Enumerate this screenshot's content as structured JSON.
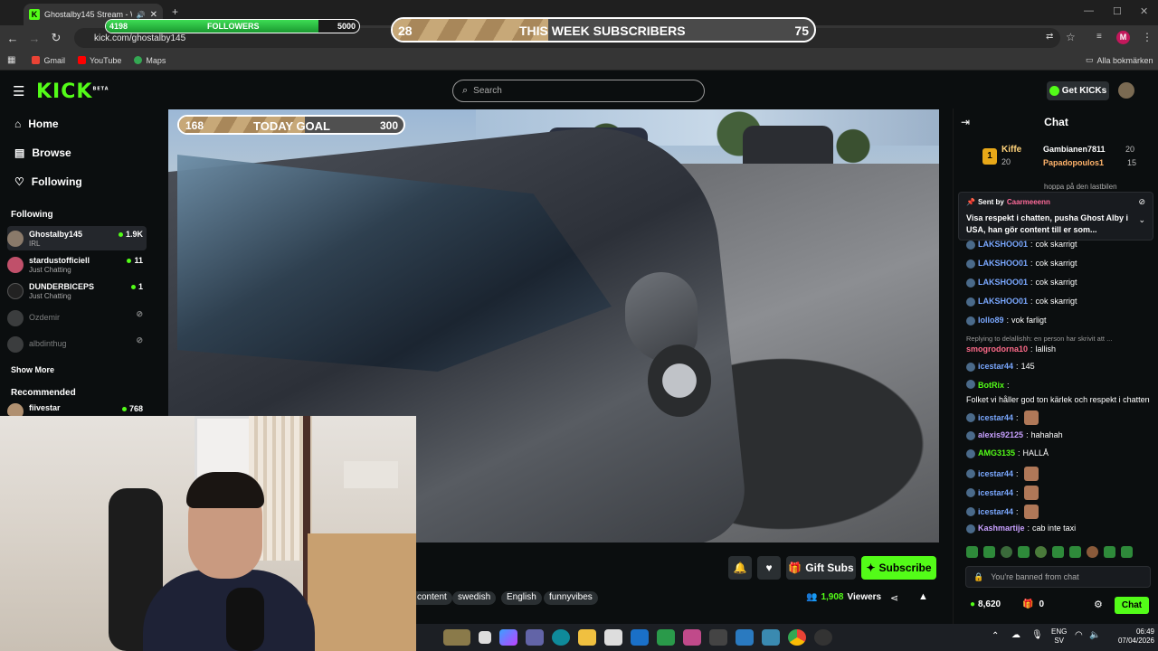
{
  "browser": {
    "tab_title": "Ghostalby145 Stream - Wa",
    "url": "kick.com/ghostalby145",
    "bookmarks": [
      "Gmail",
      "YouTube",
      "Maps"
    ],
    "all_bookmarks": "Alla bokmärken",
    "profile_initial": "M"
  },
  "overlay": {
    "followers_current": "4198",
    "followers_label": "FOLLOWERS",
    "followers_goal": "5000",
    "followers_progress": 0.84,
    "week_current": "28",
    "week_label": "THIS WEEK SUBSCRIBERS",
    "week_goal": "75",
    "week_progress": 0.37,
    "today_current": "168",
    "today_label": "TODAY GOAL",
    "today_goal": "300",
    "today_progress": 0.56
  },
  "header": {
    "logo": "KICK",
    "logo_badge": "BETA",
    "search_placeholder": "Search",
    "get_kicks": "Get KICKs"
  },
  "sidebar": {
    "nav": [
      {
        "label": "Home",
        "icon": "home-icon"
      },
      {
        "label": "Browse",
        "icon": "browse-icon"
      },
      {
        "label": "Following",
        "icon": "heart-icon"
      }
    ],
    "following_heading": "Following",
    "following": [
      {
        "name": "Ghostalby145",
        "sub": "IRL",
        "count": "1.9K",
        "live": true
      },
      {
        "name": "stardustofficiell",
        "sub": "Just Chatting",
        "count": "11",
        "live": true
      },
      {
        "name": "DUNDERBICEPS",
        "sub": "Just Chatting",
        "count": "1",
        "live": true
      },
      {
        "name": "Ozdemir",
        "sub": "",
        "count": "",
        "live": false
      },
      {
        "name": "albdinthug",
        "sub": "",
        "count": "",
        "live": false
      }
    ],
    "show_more": "Show More",
    "recommended_heading": "Recommended",
    "recommended": [
      {
        "name": "fiivestar",
        "count": "768"
      }
    ]
  },
  "stream": {
    "gift_subs": "Gift Subs",
    "subscribe": "Subscribe",
    "tags": [
      "content",
      "swedish",
      "English",
      "funnyvibes"
    ],
    "viewers": "1,908",
    "viewers_label": "Viewers"
  },
  "chat": {
    "title": "Chat",
    "leaders": [
      {
        "rank": "1",
        "name": "Kiffe",
        "count": "20"
      },
      {
        "name": "Gambianen7811",
        "count": "20"
      },
      {
        "name": "Papadopoulos1",
        "count": "15"
      }
    ],
    "pinned": {
      "sent_by": "Sent by",
      "user": "Caarmeeenn",
      "text": "Visa respekt i chatten, pusha Ghost Alby i USA, han gör content till er som..."
    },
    "partial_top": "hoppa på den lastbilen",
    "messages": [
      {
        "user": "LAKSHOO01",
        "text": "cok skarrigt",
        "color": "#7aa8ff"
      },
      {
        "user": "LAKSHOO01",
        "text": "cok skarrigt",
        "color": "#7aa8ff"
      },
      {
        "user": "LAKSHOO01",
        "text": "cok skarrigt",
        "color": "#7aa8ff"
      },
      {
        "user": "LAKSHOO01",
        "text": "cok skarrigt",
        "color": "#7aa8ff"
      },
      {
        "user": "lollo89",
        "text": "vok farligt",
        "color": "#7aa8ff"
      },
      {
        "reply": "Replying to delallishh: en person har skrivit att ...",
        "user": "smogrodorna10",
        "text": "lallish",
        "color": "#ff6b8a"
      },
      {
        "user": "icestar44",
        "text": "145",
        "color": "#7aa8ff"
      },
      {
        "user": "BotRix",
        "text": "Folket vi håller god ton kärlek och respekt i chatten",
        "color": "#53fc18"
      },
      {
        "user": "icestar44",
        "text": "",
        "color": "#7aa8ff"
      },
      {
        "user": "alexis92125",
        "text": "hahahah",
        "color": "#c8a0ff"
      },
      {
        "user": "AMG3135",
        "text": "HALLÅ",
        "color": "#53fc18"
      },
      {
        "user": "icestar44",
        "text": "",
        "color": "#7aa8ff"
      },
      {
        "user": "icestar44",
        "text": "",
        "color": "#7aa8ff"
      },
      {
        "user": "icestar44",
        "text": "",
        "color": "#7aa8ff"
      },
      {
        "user": "Kashmartije",
        "text": "cab inte taxi",
        "color": "#c8a0ff"
      }
    ],
    "banned_placeholder": "You're banned from chat",
    "kicks_balance": "8,620",
    "gift_count": "0",
    "chat_button": "Chat"
  },
  "taskbar": {
    "lang": "ENG",
    "region": "SV",
    "time": "06:49",
    "date": "07/04/2026"
  }
}
